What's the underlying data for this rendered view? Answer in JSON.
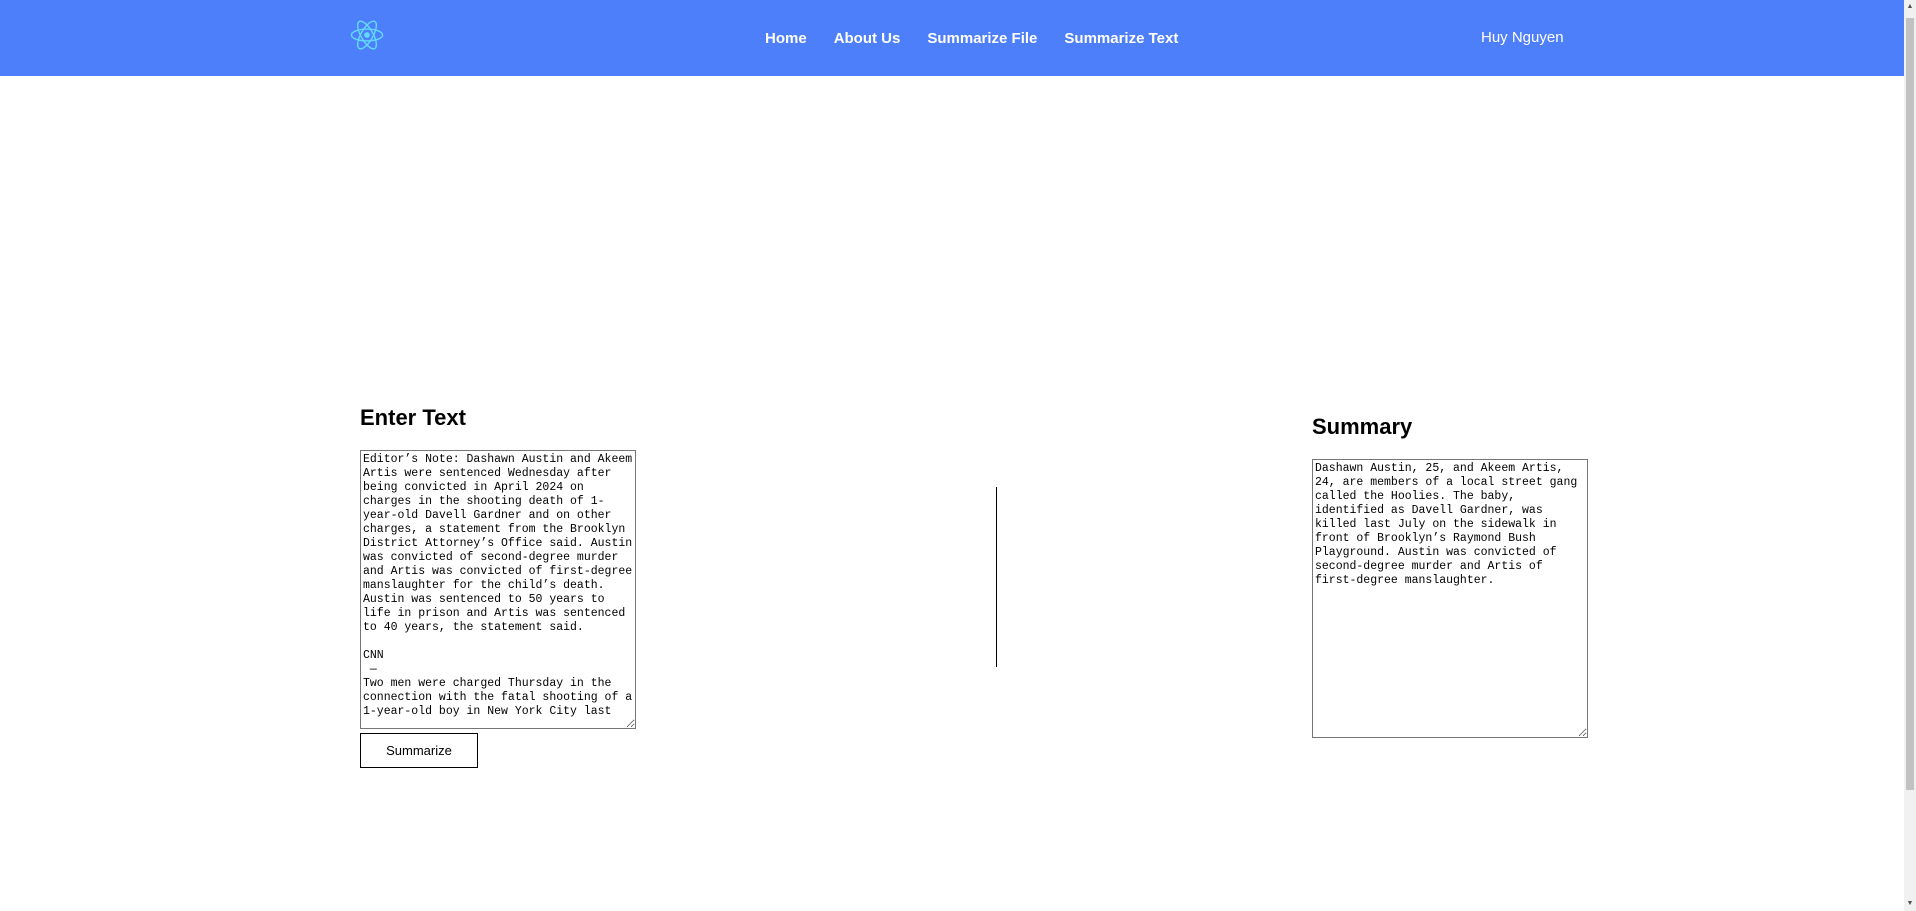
{
  "navbar": {
    "logo_icon": "react-atom-icon",
    "links": [
      "Home",
      "About Us",
      "Summarize File",
      "Summarize Text"
    ],
    "user_name": "Huy Nguyen",
    "background_color": "#4e7ffb"
  },
  "input_section": {
    "title": "Enter Text",
    "text": "Editor’s Note: Dashawn Austin and Akeem Artis were sentenced Wednesday after being convicted in April 2024 on charges in the shooting death of 1-year-old Davell Gardner and on other charges, a statement from the Brooklyn District Attorney’s Office said. Austin was convicted of second-degree murder and Artis was convicted of first-degree manslaughter for the child’s death. Austin was sentenced to 50 years to life in prison and Artis was sentenced to 40 years, the statement said.\n\nCNN\n —\nTwo men were charged Thursday in the connection with the fatal shooting of a 1-year-old boy in New York City last",
    "button_label": "Summarize"
  },
  "summary_section": {
    "title": "Summary",
    "text": "Dashawn Austin, 25, and Akeem Artis, 24, are members of a local street gang called the Hoolies. The baby, identified as Davell Gardner, was killed last July on the sidewalk in front of Brooklyn’s Raymond Bush Playground. Austin was convicted of second-degree murder and Artis of first-degree manslaughter."
  }
}
